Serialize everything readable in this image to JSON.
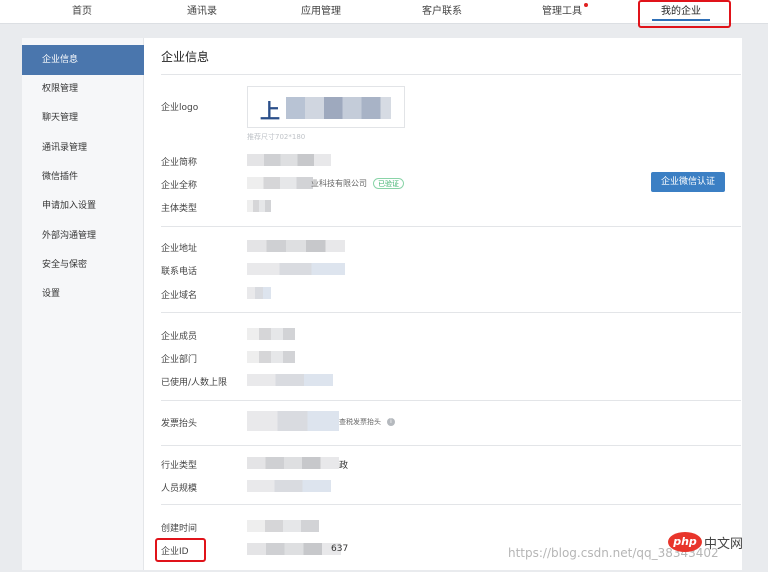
{
  "topnav": {
    "tabs": [
      {
        "label": "首页"
      },
      {
        "label": "通讯录"
      },
      {
        "label": "应用管理"
      },
      {
        "label": "客户联系"
      },
      {
        "label": "管理工具"
      },
      {
        "label": "我的企业"
      }
    ],
    "active_tab": "我的企业"
  },
  "sidebar": {
    "items": [
      {
        "label": "企业信息"
      },
      {
        "label": "权限管理"
      },
      {
        "label": "聊天管理"
      },
      {
        "label": "通讯录管理"
      },
      {
        "label": "微信插件"
      },
      {
        "label": "申请加入设置"
      },
      {
        "label": "外部沟通管理"
      },
      {
        "label": "安全与保密"
      },
      {
        "label": "设置"
      }
    ],
    "active_item": "企业信息"
  },
  "main": {
    "title": "企业信息",
    "logo_label": "企业logo",
    "logo_text": "上",
    "logo_caption": "推荐尺寸702*180",
    "fields": {
      "short_name": {
        "label": "企业简称"
      },
      "full_name": {
        "label": "企业全称",
        "visible_fragment": "业科技有限公司",
        "badge": "已验证"
      },
      "subject_type": {
        "label": "主体类型"
      },
      "address": {
        "label": "企业地址"
      },
      "phone": {
        "label": "联系电话"
      },
      "domain": {
        "label": "企业域名"
      },
      "members": {
        "label": "企业成员"
      },
      "departments": {
        "label": "企业部门"
      },
      "used_limit": {
        "label": "已使用/人数上限"
      },
      "invoice": {
        "label": "发票抬头",
        "visible_fragment": "查税发票抬头"
      },
      "industry": {
        "label": "行业类型",
        "visible_fragment": "政"
      },
      "scale": {
        "label": "人员规模"
      },
      "created": {
        "label": "创建时间"
      },
      "corp_id": {
        "label": "企业ID",
        "visible_fragment": "637"
      }
    },
    "verify_button": "企业微信认证"
  },
  "watermark": {
    "url": "https://blog.csdn.net/qq_38343402",
    "php_logo": "php",
    "php_cn": "中文网"
  },
  "colors": {
    "active_blue": "#4a76ad",
    "button_blue": "#3b7fc4",
    "highlight_red": "#e0131a"
  }
}
